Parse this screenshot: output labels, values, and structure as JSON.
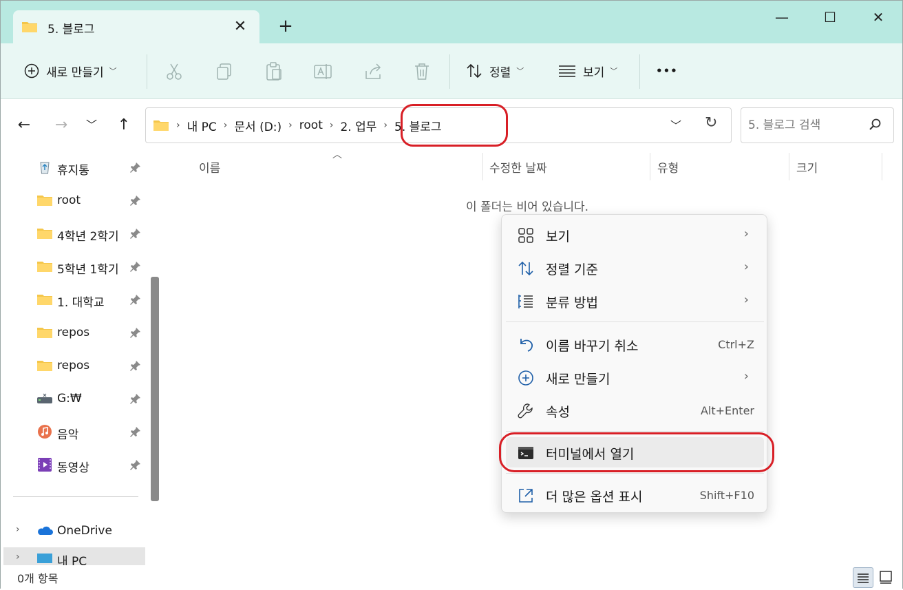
{
  "tab": {
    "title": "5. 블로그"
  },
  "toolbar": {
    "new_label": "새로 만들기",
    "sort_label": "정렬",
    "view_label": "보기",
    "more_label": "•••"
  },
  "address": {
    "crumbs": [
      "내 PC",
      "문서 (D:)",
      "root",
      "2. 업무",
      "5. 블로그"
    ],
    "search_placeholder": "5. 블로그 검색"
  },
  "sidebar": {
    "items": [
      {
        "label": "휴지통",
        "icon": "recycle-bin-icon"
      },
      {
        "label": "root",
        "icon": "folder-icon"
      },
      {
        "label": "4학년 2학기",
        "icon": "folder-icon"
      },
      {
        "label": "5학년 1학기",
        "icon": "folder-icon"
      },
      {
        "label": "1. 대학교",
        "icon": "folder-icon"
      },
      {
        "label": "repos",
        "icon": "folder-icon"
      },
      {
        "label": "repos",
        "icon": "folder-icon"
      },
      {
        "label": "G:₩",
        "icon": "drive-icon"
      },
      {
        "label": "음악",
        "icon": "music-icon"
      },
      {
        "label": "동영상",
        "icon": "video-icon"
      }
    ],
    "onedrive": "OneDrive",
    "thispc": "내 PC"
  },
  "columns": {
    "name": "이름",
    "modified": "수정한 날짜",
    "type": "유형",
    "size": "크기"
  },
  "empty_message": "이 폴더는 비어 있습니다.",
  "status": {
    "count": "0개 항목"
  },
  "context_menu": {
    "items": [
      {
        "label": "보기",
        "icon": "grid-icon",
        "submenu": true
      },
      {
        "label": "정렬 기준",
        "icon": "sort-icon",
        "submenu": true
      },
      {
        "label": "분류 방법",
        "icon": "group-list-icon",
        "submenu": true
      },
      {
        "label": "이름 바꾸기 취소",
        "icon": "undo-icon",
        "shortcut": "Ctrl+Z"
      },
      {
        "label": "새로 만들기",
        "icon": "new-icon",
        "submenu": true
      },
      {
        "label": "속성",
        "icon": "wrench-icon",
        "shortcut": "Alt+Enter"
      },
      {
        "label": "터미널에서 열기",
        "icon": "terminal-icon"
      },
      {
        "label": "더 많은 옵션 표시",
        "icon": "more-options-icon",
        "shortcut": "Shift+F10"
      }
    ]
  },
  "colors": {
    "titlebar": "#b8e9e1",
    "commandbar": "#e9f7f4",
    "annotation": "#d81f26",
    "folder": "#f4c64a"
  }
}
